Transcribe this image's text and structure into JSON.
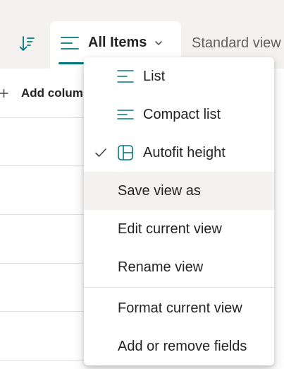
{
  "toolbar": {
    "sort_icon": "sort-descending-icon",
    "tabs": [
      {
        "label": "All Items",
        "icon": "list-view-icon",
        "selected": true
      },
      {
        "label": "Standard view"
      }
    ]
  },
  "list": {
    "add_column_label": "Add column"
  },
  "menu": {
    "items": [
      {
        "label": "List",
        "icon": "list-icon"
      },
      {
        "label": "Compact list",
        "icon": "compact-list-icon"
      },
      {
        "label": "Autofit height",
        "icon": "autofit-grid-icon",
        "checked": true
      },
      {
        "label": "Save view as",
        "hovered": true
      },
      {
        "label": "Edit current view"
      },
      {
        "label": "Rename view"
      },
      {
        "label": "Format current view"
      },
      {
        "label": "Add or remove fields"
      }
    ]
  },
  "colors": {
    "accent": "#03787c",
    "toolbar_bg": "#f3f2f1",
    "hover_bg": "#f3f2f1",
    "text": "#242424"
  }
}
